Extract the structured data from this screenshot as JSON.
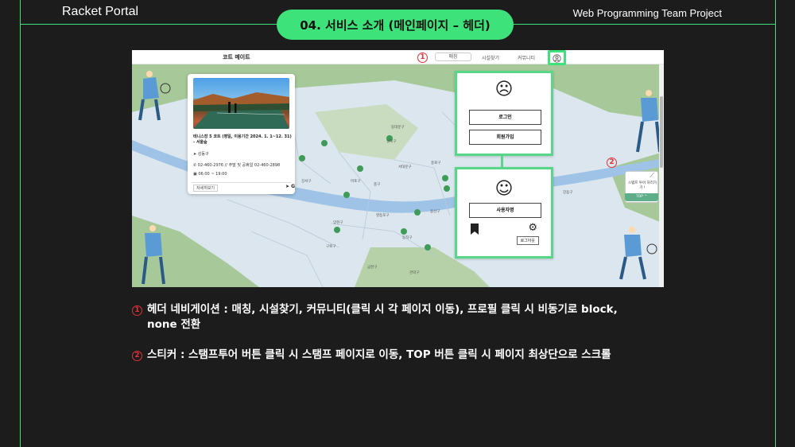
{
  "slide": {
    "brand": "Racket Portal",
    "project": "Web Programming Team Project",
    "section_title": "04. 서비스 소개 (메인페이지 – 헤더)"
  },
  "screenshot": {
    "header": {
      "logo": "코트 메이트",
      "nav": [
        "매칭",
        "시설찾기",
        "커뮤니티"
      ]
    },
    "card": {
      "title": "테니스장 5 코트 (평일, 이용기간 2024. 1. 1~12. 31) - 서울숲",
      "district": "성동구",
      "phone": "02-460-2976 // 주말 및 공휴일 02-460-2898",
      "hours": "06:00 ~ 19:00",
      "more_button": "자세히보기",
      "share_label": "G"
    },
    "dropdown_logged_out": {
      "face": "☹",
      "login": "로그인",
      "signup": "회원가입"
    },
    "dropdown_logged_in": {
      "face": "☺",
      "username": "사용자명",
      "logout": "로그아웃"
    },
    "sticker": {
      "label": "스탬프 투어 하러가기 !",
      "top": "TOP ^"
    },
    "districts": [
      "동대문구",
      "성북구",
      "서대문구",
      "종로구",
      "마포구",
      "중구",
      "강서구",
      "용산구",
      "영등포구",
      "동작구",
      "강동구",
      "관악구",
      "구로구",
      "양천구",
      "금천구"
    ],
    "markers": {
      "one": "1",
      "two": "2"
    }
  },
  "descriptions": [
    {
      "num": "1",
      "text": "헤더 네비게이션 : 매칭, 시설찾기, 커뮤니티(클릭 시 각 페이지 이동), 프로필 클릭 시 비동기로 block, none 전환"
    },
    {
      "num": "2",
      "text": "스티커 : 스탬프투어 버튼 클릭 시 스탬프 페이지로 이동, TOP 버튼 클릭 시 페이지 최상단으로 스크롤"
    }
  ],
  "colors": {
    "accent": "#3ee27a",
    "marker": "#e0323a",
    "background": "#1c1c1c"
  }
}
